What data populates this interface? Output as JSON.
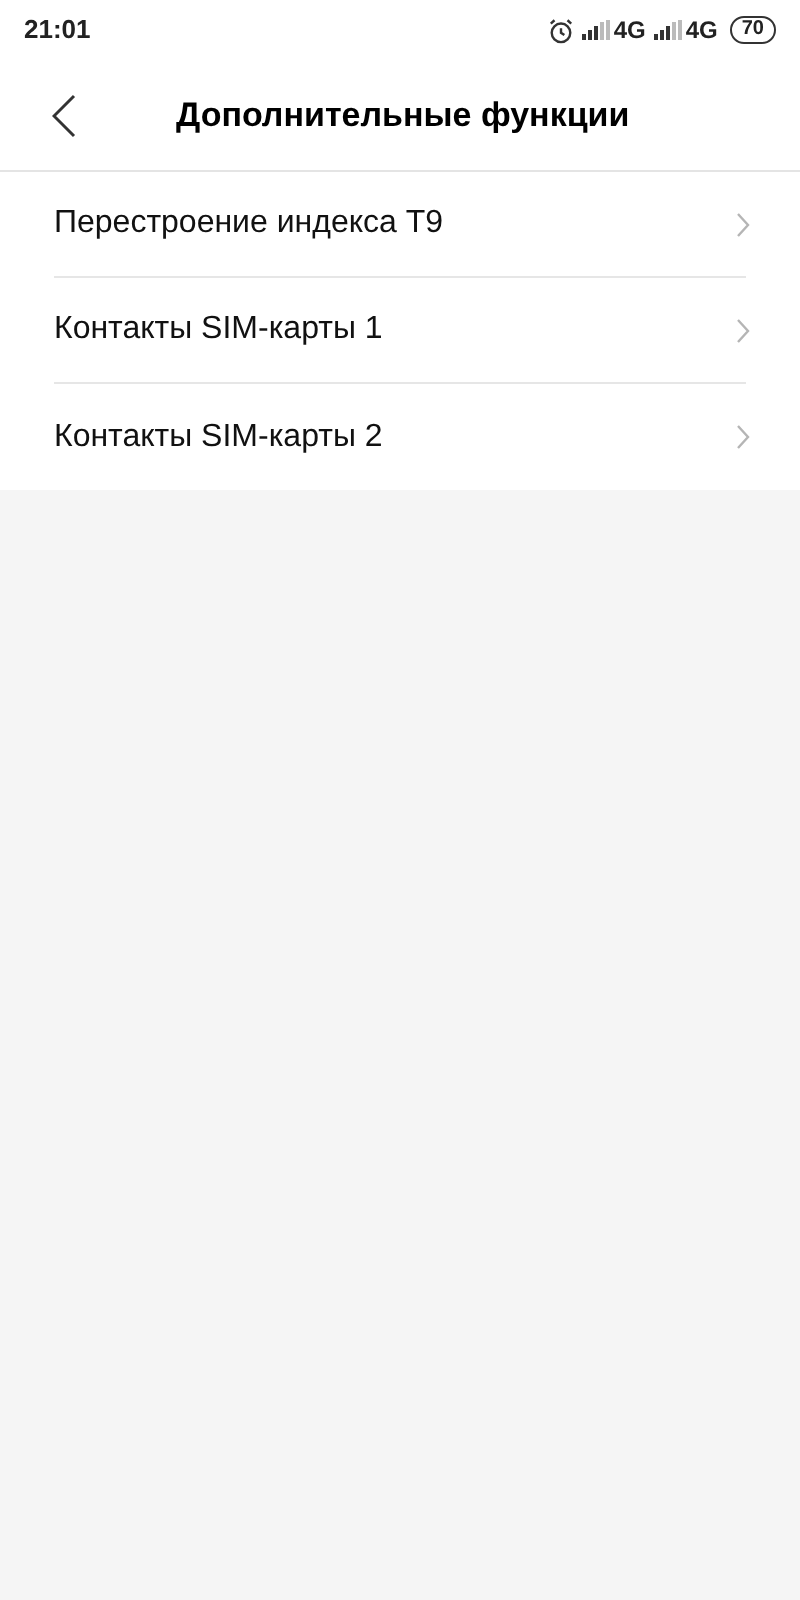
{
  "status_bar": {
    "time": "21:01",
    "networks": [
      "4G",
      "4G"
    ],
    "battery": "70"
  },
  "header": {
    "title": "Дополнительные функции"
  },
  "items": [
    {
      "label": "Перестроение индекса T9"
    },
    {
      "label": "Контакты SIM-карты 1"
    },
    {
      "label": "Контакты SIM-карты 2"
    }
  ]
}
